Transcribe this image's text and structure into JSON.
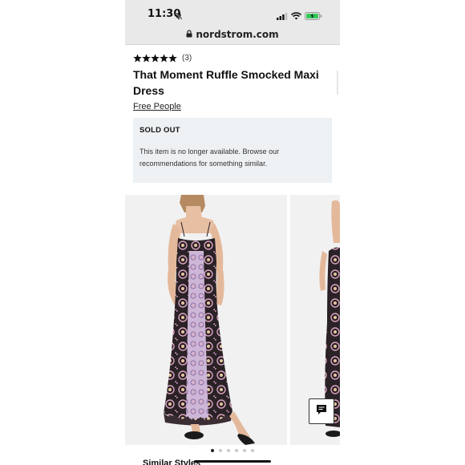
{
  "status_bar": {
    "time": "11:30",
    "icons": [
      "bell-slash-icon",
      "signal-icon",
      "wifi-icon",
      "battery-charging-icon"
    ]
  },
  "browser": {
    "url": "nordstrom.com",
    "lock_icon": "lock-icon"
  },
  "product": {
    "rating_stars": 5,
    "review_count": "(3)",
    "title": "That Moment Ruffle Smocked Maxi Dress",
    "brand": "Free People"
  },
  "availability": {
    "status": "SOLD OUT",
    "message": "This item is no longer available. Browse our recommendations for something similar."
  },
  "gallery": {
    "image_count": 6,
    "active_index": 0
  },
  "chat": {
    "icon": "chat-bubble-icon"
  },
  "section": {
    "similar_label": "Similar Styles"
  },
  "colors": {
    "background": "#ffffff",
    "browser_chrome": "#e9e9e9",
    "notice_bg": "#eef1f3",
    "text": "#111111",
    "dress_dark": "#2a2226",
    "dress_pink": "#d9a3c0"
  }
}
